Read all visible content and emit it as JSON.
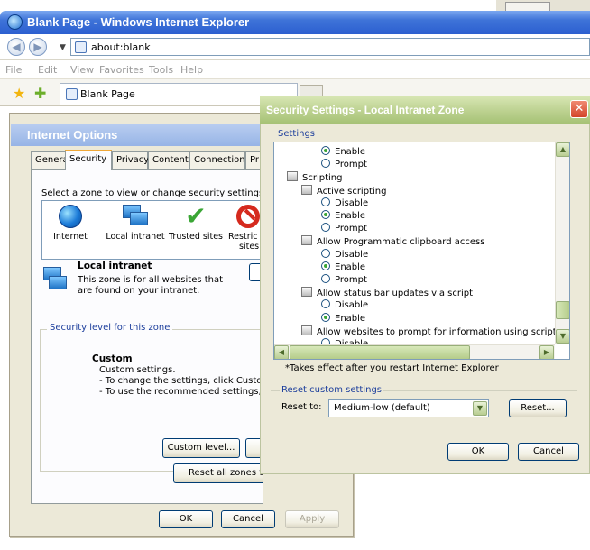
{
  "browser": {
    "title": "Blank Page - Windows Internet Explorer",
    "address": "about:blank",
    "menu": [
      "File",
      "Edit",
      "View",
      "Favorites",
      "Tools",
      "Help"
    ],
    "tab_label": "Blank Page"
  },
  "internet_options": {
    "title": "Internet Options",
    "tabs": [
      "General",
      "Security",
      "Privacy",
      "Content",
      "Connections",
      "Pr"
    ],
    "active_tab": "Security",
    "zone_prompt": "Select a zone to view or change security settings.",
    "zones": [
      {
        "label": "Internet",
        "icon": "globe-icon"
      },
      {
        "label": "Local intranet",
        "icon": "computers-icon"
      },
      {
        "label": "Trusted sites",
        "icon": "checkmark-icon"
      },
      {
        "label": "Restric",
        "label2": "sites",
        "icon": "no-entry-icon"
      }
    ],
    "selected_zone_title": "Local intranet",
    "selected_zone_desc": "This zone is for all websites that are found on your intranet.",
    "security_level_legend": "Security level for this zone",
    "custom_title": "Custom",
    "custom_lines": [
      "Custom settings.",
      "- To change the settings, click Custom lev",
      "- To use the recommended settings, click I"
    ],
    "custom_level_button": "Custom level...",
    "reset_all_button": "Reset all zones to",
    "ok": "OK",
    "cancel": "Cancel",
    "apply": "Apply"
  },
  "security_settings": {
    "title": "Security Settings - Local Intranet Zone",
    "settings_label": "Settings",
    "tree": [
      {
        "kind": "radio",
        "label": "Enable",
        "checked": true,
        "indent": 2
      },
      {
        "kind": "radio",
        "label": "Prompt",
        "checked": false,
        "indent": 2
      },
      {
        "kind": "group",
        "label": "Scripting",
        "indent": 0
      },
      {
        "kind": "group",
        "label": "Active scripting",
        "indent": 1
      },
      {
        "kind": "radio",
        "label": "Disable",
        "checked": false,
        "indent": 2
      },
      {
        "kind": "radio",
        "label": "Enable",
        "checked": true,
        "indent": 2
      },
      {
        "kind": "radio",
        "label": "Prompt",
        "checked": false,
        "indent": 2
      },
      {
        "kind": "group",
        "label": "Allow Programmatic clipboard access",
        "indent": 1
      },
      {
        "kind": "radio",
        "label": "Disable",
        "checked": false,
        "indent": 2
      },
      {
        "kind": "radio",
        "label": "Enable",
        "checked": true,
        "indent": 2
      },
      {
        "kind": "radio",
        "label": "Prompt",
        "checked": false,
        "indent": 2
      },
      {
        "kind": "group",
        "label": "Allow status bar updates via script",
        "indent": 1
      },
      {
        "kind": "radio",
        "label": "Disable",
        "checked": false,
        "indent": 2
      },
      {
        "kind": "radio",
        "label": "Enable",
        "checked": true,
        "indent": 2
      },
      {
        "kind": "group",
        "label": "Allow websites to prompt for information using scripted windo",
        "indent": 1
      },
      {
        "kind": "radio",
        "label": "Disable",
        "checked": false,
        "indent": 2
      }
    ],
    "restart_note": "*Takes effect after you restart Internet Explorer",
    "reset_legend": "Reset custom settings",
    "reset_to_label": "Reset to:",
    "reset_to_value": "Medium-low (default)",
    "reset_button": "Reset...",
    "ok": "OK",
    "cancel": "Cancel"
  }
}
